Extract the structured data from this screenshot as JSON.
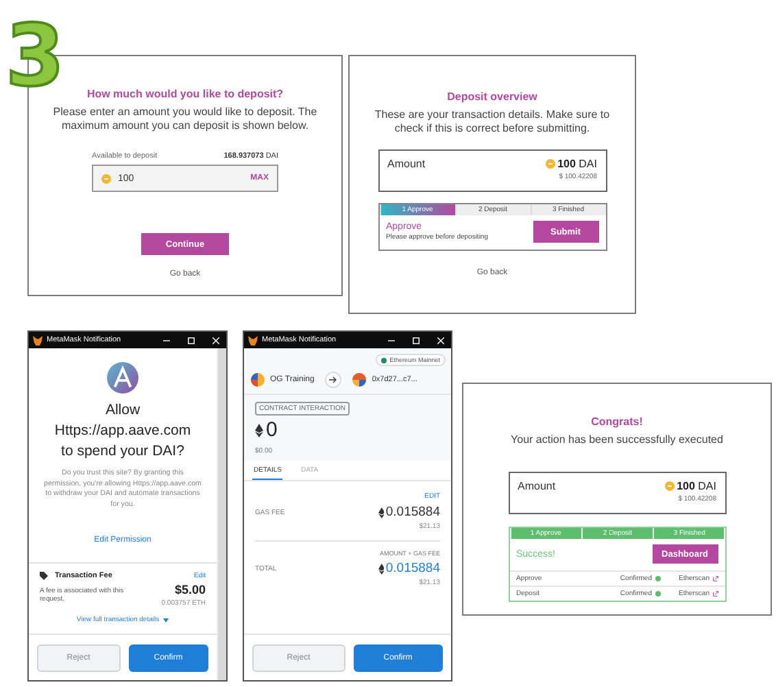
{
  "step_number": "3",
  "deposit_form": {
    "title": "How much would you like to deposit?",
    "description": "Please enter an amount you would like to deposit. The maximum amount you can deposit is shown below.",
    "available_label": "Available to deposit",
    "available_amount": "168.937073",
    "available_unit": "DAI",
    "amount_value": "100",
    "max_label": "MAX",
    "continue_label": "Continue",
    "back_label": "Go back"
  },
  "overview": {
    "title": "Deposit overview",
    "description": "These are your transaction details. Make sure to check if this is correct before submitting.",
    "amount_label": "Amount",
    "amount_value": "100",
    "amount_unit": "DAI",
    "amount_usd": "$ 100.42208",
    "steps": [
      {
        "label": "1 Approve",
        "selected": true
      },
      {
        "label": "2 Deposit",
        "selected": false
      },
      {
        "label": "3 Finished",
        "selected": false
      }
    ],
    "step_title": "Approve",
    "step_hint": "Please approve before depositing",
    "submit_label": "Submit",
    "back_label": "Go back"
  },
  "approve_popup": {
    "window_title": "MetaMask Notification",
    "heading": [
      "Allow",
      "Https://app.aave.com",
      "to spend your DAI?"
    ],
    "body": "Do you trust this site? By granting this permission, you're allowing Https://app.aave.com to withdraw your DAI and automate transactions for you.",
    "edit_permission": "Edit Permission",
    "fee_title": "Transaction Fee",
    "fee_edit": "Edit",
    "fee_note": "A fee is associated with this request.",
    "fee_usd": "$5.00",
    "fee_eth": "0.003757 ETH",
    "details_link": "View full transaction details",
    "reject_label": "Reject",
    "confirm_label": "Confirm"
  },
  "tx_popup": {
    "window_title": "MetaMask Notification",
    "network": "Ethereum Mainnet",
    "from": "OG Training",
    "to": "0x7d27...c7...",
    "badge": "CONTRACT INTERACTION",
    "amount": "0",
    "amount_usd": "$0.00",
    "tabs": [
      {
        "label": "DETAILS",
        "selected": true
      },
      {
        "label": "DATA",
        "selected": false
      }
    ],
    "edit_label": "EDIT",
    "gas_label": "GAS FEE",
    "gas_value": "0.015884",
    "gas_usd": "$21.13",
    "total_caption": "AMOUNT + GAS FEE",
    "total_label": "TOTAL",
    "total_value": "0.015884",
    "total_usd": "$21.13",
    "reject_label": "Reject",
    "confirm_label": "Confirm"
  },
  "success": {
    "title": "Congrats!",
    "description": "Your action has been successfully executed",
    "amount_label": "Amount",
    "amount_value": "100",
    "amount_unit": "DAI",
    "amount_usd": "$ 100.42208",
    "steps": [
      {
        "label": "1 Approve",
        "done": true
      },
      {
        "label": "2 Deposit",
        "done": true
      },
      {
        "label": "3 Finished",
        "done": true
      }
    ],
    "status": "Success!",
    "dashboard_label": "Dashboard",
    "rows": [
      {
        "action": "Approve",
        "status": "Confirmed",
        "link": "Etherscan"
      },
      {
        "action": "Deposit",
        "status": "Confirmed",
        "link": "Etherscan"
      }
    ]
  }
}
